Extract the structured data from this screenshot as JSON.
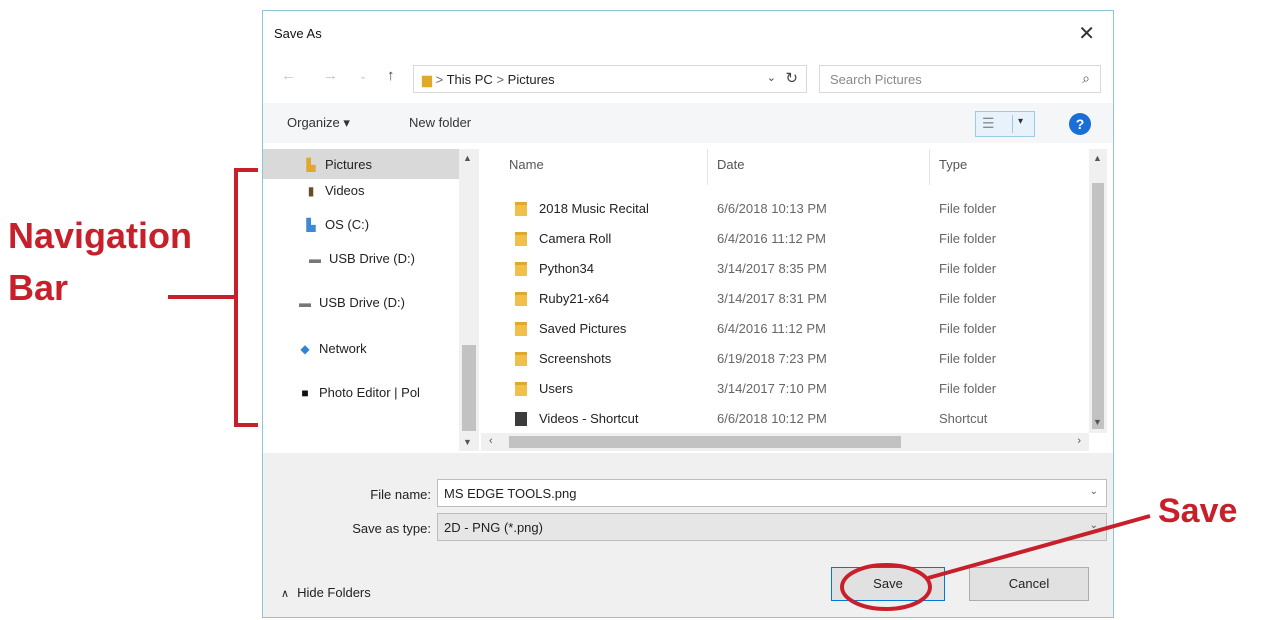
{
  "annotations": {
    "navigation_label_line1": "Navigation",
    "navigation_label_line2": "Bar",
    "save_label": "Save",
    "accent_color": "#c8202a"
  },
  "dialog": {
    "title": "Save As",
    "close_icon": "close-icon",
    "address": {
      "crumb_root": "This PC",
      "separator": ">",
      "crumb_current": "Pictures"
    },
    "search": {
      "placeholder": "Search Pictures"
    },
    "toolbar": {
      "organize": "Organize ▾",
      "new_folder": "New folder",
      "help": "?"
    },
    "nav_pane": [
      {
        "label": "Pictures",
        "icon": "folder-icon",
        "selected": true
      },
      {
        "label": "Videos",
        "icon": "videos-icon"
      },
      {
        "label": "OS (C:)",
        "icon": "drive-icon"
      },
      {
        "label": "USB Drive (D:)",
        "icon": "usb-drive-icon"
      },
      {
        "label": "USB Drive (D:)",
        "icon": "usb-drive-icon"
      },
      {
        "label": "Network",
        "icon": "network-icon"
      },
      {
        "label": "Photo Editor | Pol",
        "icon": "app-icon"
      }
    ],
    "columns": {
      "name": "Name",
      "date": "Date",
      "type": "Type"
    },
    "files": [
      {
        "name": "2018 Music Recital",
        "date": "6/6/2018 10:13 PM",
        "type": "File folder",
        "icon": "folder-icon"
      },
      {
        "name": "Camera Roll",
        "date": "6/4/2016 11:12 PM",
        "type": "File folder",
        "icon": "folder-icon"
      },
      {
        "name": "Python34",
        "date": "3/14/2017 8:35 PM",
        "type": "File folder",
        "icon": "folder-icon"
      },
      {
        "name": "Ruby21-x64",
        "date": "3/14/2017 8:31 PM",
        "type": "File folder",
        "icon": "folder-icon"
      },
      {
        "name": "Saved Pictures",
        "date": "6/4/2016 11:12 PM",
        "type": "File folder",
        "icon": "folder-icon"
      },
      {
        "name": "Screenshots",
        "date": "6/19/2018 7:23 PM",
        "type": "File folder",
        "icon": "folder-icon"
      },
      {
        "name": "Users",
        "date": "3/14/2017 7:10 PM",
        "type": "File folder",
        "icon": "folder-icon"
      },
      {
        "name": "Videos - Shortcut",
        "date": "6/6/2018 10:12 PM",
        "type": "Shortcut",
        "icon": "shortcut-icon"
      }
    ],
    "file_name": {
      "label": "File name:",
      "value": "MS EDGE TOOLS.png"
    },
    "save_as_type": {
      "label": "Save as type:",
      "value": "2D - PNG (*.png)"
    },
    "hide_folders": "Hide Folders",
    "save_button": "Save",
    "cancel_button": "Cancel"
  }
}
